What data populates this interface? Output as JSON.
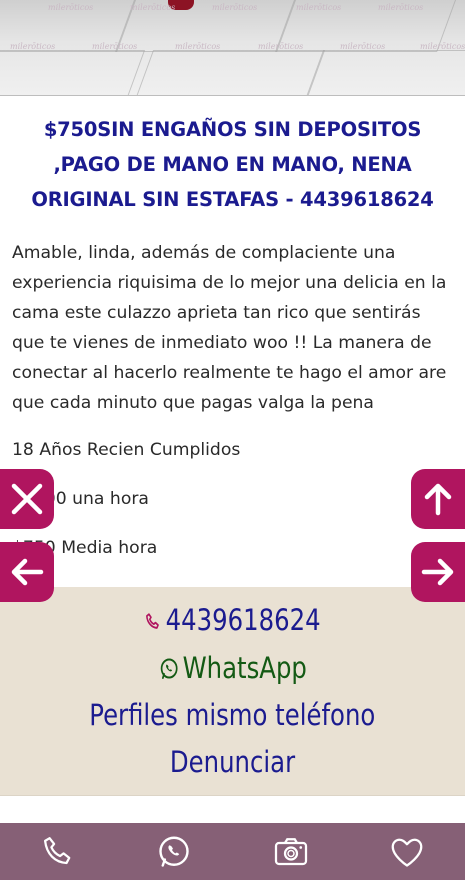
{
  "ad": {
    "title": "$750SIN ENGAÑOS SIN DEPOSITOS ,PAGO DE MANO EN MANO, NENA ORIGINAL SIN ESTAFAS - 4439618624",
    "description": "Amable, linda, además de complaciente una experiencia riquisima de lo mejor una delicia en la cama este culazzo aprieta tan rico que sentirás que te vienes de inmediato woo !! La manera de conectar al hacerlo realmente te hago el amor are que cada minuto que pagas valga la pena",
    "age": "18 Años Recien Cumplidos",
    "rate_hour": "$1300 una hora",
    "rate_half": "$750 Media hora"
  },
  "watermark": "milerōticos",
  "contact": {
    "phone": "4439618624",
    "whatsapp_label": "WhatsApp",
    "same_phone_label": "Perfiles mismo teléfono",
    "report_label": "Denunciar"
  },
  "colors": {
    "title": "#1b1b8f",
    "side_buttons": "#b0155f",
    "bottom_bar": "#866076",
    "contact_bg": "#e9e1d3",
    "whatsapp_text": "#145a14"
  },
  "icons": {
    "close": "close-icon",
    "up": "arrow-up-icon",
    "back": "arrow-left-icon",
    "next": "arrow-right-icon",
    "phone": "phone-icon",
    "whatsapp": "whatsapp-icon",
    "camera": "camera-icon",
    "favorite": "heart-icon"
  }
}
